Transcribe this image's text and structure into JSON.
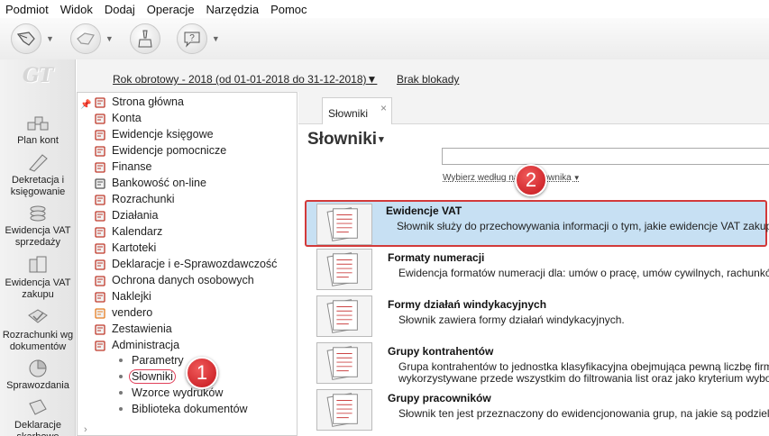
{
  "menu": [
    "Podmiot",
    "Widok",
    "Dodaj",
    "Operacje",
    "Narzędzia",
    "Pomoc"
  ],
  "toolbar": {
    "buttons": [
      {
        "name": "back-icon"
      },
      {
        "name": "forward-icon"
      },
      {
        "name": "clean-icon"
      },
      {
        "name": "help-icon"
      }
    ]
  },
  "logo": "GT",
  "leftnav": {
    "items": [
      {
        "label": "Plan kont",
        "icon": "chart-of-accounts-icon"
      },
      {
        "label": "Dekretacja i księgowanie",
        "icon": "posting-icon"
      },
      {
        "label": "Ewidencja VAT sprzedaży",
        "icon": "vat-sales-icon"
      },
      {
        "label": "Ewidencja VAT zakupu",
        "icon": "vat-purchase-icon"
      },
      {
        "label": "Rozrachunki wg dokumentów",
        "icon": "settlements-icon"
      },
      {
        "label": "Sprawozdania",
        "icon": "reports-icon"
      },
      {
        "label": "Deklaracje skarbowe",
        "icon": "tax-declarations-icon"
      }
    ]
  },
  "infobar": {
    "year": "Rok obrotowy - 2018  (od 01-01-2018 do 31-12-2018)",
    "year_caret": "▼",
    "lock": "Brak blokady"
  },
  "tree": {
    "items": [
      {
        "label": "Strona główna",
        "icon": "home-icon",
        "color": "#c0392b"
      },
      {
        "label": "Konta",
        "icon": "accounts-icon",
        "color": "#c0392b"
      },
      {
        "label": "Ewidencje księgowe",
        "icon": "ledger-icon",
        "color": "#c0392b"
      },
      {
        "label": "Ewidencje pomocnicze",
        "icon": "auxiliary-icon",
        "color": "#c0392b"
      },
      {
        "label": "Finanse",
        "icon": "finance-icon",
        "color": "#c0392b"
      },
      {
        "label": "Bankowość on-line",
        "icon": "bank-icon",
        "color": "#555555"
      },
      {
        "label": "Rozrachunki",
        "icon": "settlements-icon",
        "color": "#c0392b"
      },
      {
        "label": "Działania",
        "icon": "actions-icon",
        "color": "#c0392b"
      },
      {
        "label": "Kalendarz",
        "icon": "calendar-icon",
        "color": "#c0392b"
      },
      {
        "label": "Kartoteki",
        "icon": "records-icon",
        "color": "#c0392b"
      },
      {
        "label": "Deklaracje i e-Sprawozdawczość",
        "icon": "declarations-icon",
        "color": "#c0392b"
      },
      {
        "label": "Ochrona danych osobowych",
        "icon": "data-protection-icon",
        "color": "#c0392b"
      },
      {
        "label": "Naklejki",
        "icon": "stickers-icon",
        "color": "#c0392b"
      },
      {
        "label": "vendero",
        "icon": "vendero-icon",
        "color": "#e67e22"
      },
      {
        "label": "Zestawienia",
        "icon": "summaries-icon",
        "color": "#c0392b"
      },
      {
        "label": "Administracja",
        "icon": "admin-icon",
        "color": "#c0392b"
      }
    ],
    "subitems": [
      {
        "label": "Parametry"
      },
      {
        "label": "Słowniki"
      },
      {
        "label": "Wzorce wydruków"
      },
      {
        "label": "Biblioteka dokumentów"
      }
    ]
  },
  "callouts": {
    "one": "1",
    "two": "2"
  },
  "tab": {
    "label": "Słowniki",
    "close": "×"
  },
  "page": {
    "title": "Słowniki",
    "title_caret": "▾",
    "search_value": "",
    "search_by": "Wybierz według nazwy słownika",
    "search_by_caret": "▼"
  },
  "list": [
    {
      "title": "Ewidencje VAT",
      "desc": "Słownik służy do przechowywania informacji o tym, jakie ewidencje VAT zakupu",
      "selected": true
    },
    {
      "title": "Formaty numeracji",
      "desc": "Ewidencja formatów numeracji dla: umów o pracę, umów cywilnych, rachunków,",
      "selected": false
    },
    {
      "title": "Formy działań windykacyjnych",
      "desc": "Słownik zawiera formy działań windykacyjnych.",
      "selected": false
    },
    {
      "title": "Grupy kontrahentów",
      "desc": "Grupa kontrahentów to jednostka klasyfikacyjna obejmująca pewną liczbę firm o",
      "desc2": "wykorzystywane przede wszystkim do filtrowania list oraz jako kryterium wyboru",
      "selected": false
    },
    {
      "title": "Grupy pracowników",
      "desc": "Słownik ten jest przeznaczony do ewidencjonowania grup, na jakie są podzieler",
      "selected": false
    }
  ],
  "colors": {
    "accent": "#c4151c",
    "selected_bg": "#c7e0f3",
    "selected_border": "#d23a3a"
  }
}
